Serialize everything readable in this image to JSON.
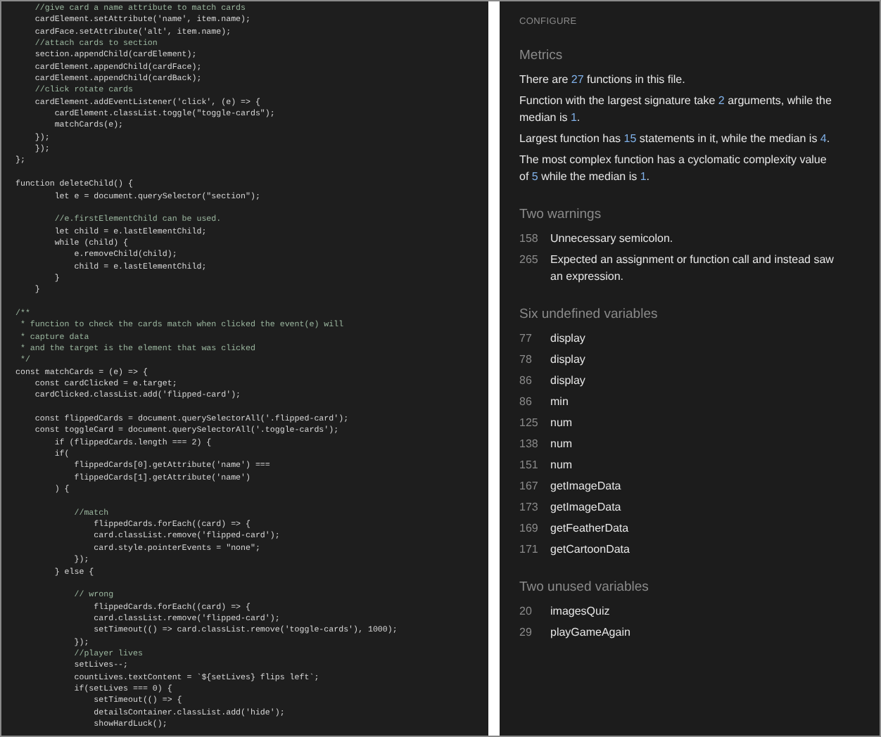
{
  "code_lines": [
    {
      "kind": "comment",
      "text": "    //give card a name attribute to match cards"
    },
    {
      "kind": "code",
      "text": "    cardElement.setAttribute('name', item.name);"
    },
    {
      "kind": "code",
      "text": "    cardFace.setAttribute('alt', item.name);"
    },
    {
      "kind": "comment",
      "text": "    //attach cards to section"
    },
    {
      "kind": "code",
      "text": "    section.appendChild(cardElement);"
    },
    {
      "kind": "code",
      "text": "    cardElement.appendChild(cardFace);"
    },
    {
      "kind": "code",
      "text": "    cardElement.appendChild(cardBack);"
    },
    {
      "kind": "comment",
      "text": "    //click rotate cards"
    },
    {
      "kind": "code",
      "text": "    cardElement.addEventListener('click', (e) => {"
    },
    {
      "kind": "code",
      "text": "        cardElement.classList.toggle(\"toggle-cards\");"
    },
    {
      "kind": "code",
      "text": "        matchCards(e);"
    },
    {
      "kind": "code",
      "text": "    });"
    },
    {
      "kind": "code",
      "text": "    });"
    },
    {
      "kind": "code",
      "text": "};"
    },
    {
      "kind": "blank"
    },
    {
      "kind": "code",
      "text": "function deleteChild() {"
    },
    {
      "kind": "code",
      "text": "        let e = document.querySelector(\"section\");"
    },
    {
      "kind": "blank"
    },
    {
      "kind": "comment",
      "text": "        //e.firstElementChild can be used."
    },
    {
      "kind": "code",
      "text": "        let child = e.lastElementChild;"
    },
    {
      "kind": "code",
      "text": "        while (child) {"
    },
    {
      "kind": "code",
      "text": "            e.removeChild(child);"
    },
    {
      "kind": "code",
      "text": "            child = e.lastElementChild;"
    },
    {
      "kind": "code",
      "text": "        }"
    },
    {
      "kind": "code",
      "text": "    }"
    },
    {
      "kind": "blank"
    },
    {
      "kind": "comment",
      "text": "/**"
    },
    {
      "kind": "comment",
      "text": " * function to check the cards match when clicked the event(e) will"
    },
    {
      "kind": "comment",
      "text": " * capture data"
    },
    {
      "kind": "comment",
      "text": " * and the target is the element that was clicked"
    },
    {
      "kind": "comment",
      "text": " */"
    },
    {
      "kind": "code",
      "text": "const matchCards = (e) => {"
    },
    {
      "kind": "code",
      "text": "    const cardClicked = e.target;"
    },
    {
      "kind": "code",
      "text": "    cardClicked.classList.add('flipped-card');"
    },
    {
      "kind": "blank"
    },
    {
      "kind": "code",
      "text": "    const flippedCards = document.querySelectorAll('.flipped-card');"
    },
    {
      "kind": "code",
      "text": "    const toggleCard = document.querySelectorAll('.toggle-cards');"
    },
    {
      "kind": "code",
      "text": "        if (flippedCards.length === 2) {"
    },
    {
      "kind": "code",
      "text": "        if("
    },
    {
      "kind": "code",
      "text": "            flippedCards[0].getAttribute('name') ==="
    },
    {
      "kind": "code",
      "text": "            flippedCards[1].getAttribute('name')"
    },
    {
      "kind": "code",
      "text": "        ) {"
    },
    {
      "kind": "blank"
    },
    {
      "kind": "comment",
      "text": "            //match"
    },
    {
      "kind": "code",
      "text": "                flippedCards.forEach((card) => {"
    },
    {
      "kind": "code",
      "text": "                card.classList.remove('flipped-card');"
    },
    {
      "kind": "code",
      "text": "                card.style.pointerEvents = \"none\";"
    },
    {
      "kind": "code",
      "text": "            });"
    },
    {
      "kind": "code",
      "text": "        } else {"
    },
    {
      "kind": "blank"
    },
    {
      "kind": "comment",
      "text": "            // wrong"
    },
    {
      "kind": "code",
      "text": "                flippedCards.forEach((card) => {"
    },
    {
      "kind": "code",
      "text": "                card.classList.remove('flipped-card');"
    },
    {
      "kind": "code",
      "text": "                setTimeout(() => card.classList.remove('toggle-cards'), 1000);"
    },
    {
      "kind": "code",
      "text": "            });"
    },
    {
      "kind": "comment",
      "text": "            //player lives"
    },
    {
      "kind": "code",
      "text": "            setLives--;"
    },
    {
      "kind": "code",
      "text": "            countLives.textContent = `${setLives} flips left`;"
    },
    {
      "kind": "code",
      "text": "            if(setLives === 0) {"
    },
    {
      "kind": "code",
      "text": "                setTimeout(() => {"
    },
    {
      "kind": "code",
      "text": "                detailsContainer.classList.add('hide');"
    },
    {
      "kind": "code",
      "text": "                showHardLuck();"
    }
  ],
  "report": {
    "configure": "CONFIGURE",
    "metrics": {
      "title": "Metrics",
      "sentences": [
        [
          {
            "kind": "text",
            "text": "There are "
          },
          {
            "kind": "number",
            "text": "27"
          },
          {
            "kind": "text",
            "text": " functions in this file."
          }
        ],
        [
          {
            "kind": "text",
            "text": "Function with the largest signature take "
          },
          {
            "kind": "number",
            "text": "2"
          },
          {
            "kind": "text",
            "text": " arguments, while the median is "
          },
          {
            "kind": "number",
            "text": "1"
          },
          {
            "kind": "text",
            "text": "."
          }
        ],
        [
          {
            "kind": "text",
            "text": "Largest function has "
          },
          {
            "kind": "number",
            "text": "15"
          },
          {
            "kind": "text",
            "text": " statements in it, while the median is "
          },
          {
            "kind": "number",
            "text": "4"
          },
          {
            "kind": "text",
            "text": "."
          }
        ],
        [
          {
            "kind": "text",
            "text": "The most complex function has a cyclomatic complexity value of "
          },
          {
            "kind": "number",
            "text": "5"
          },
          {
            "kind": "text",
            "text": " while the median is "
          },
          {
            "kind": "number",
            "text": "1"
          },
          {
            "kind": "text",
            "text": "."
          }
        ]
      ]
    },
    "sections": [
      {
        "title": "Two warnings",
        "rows": [
          {
            "line": "158",
            "message": "Unnecessary semicolon."
          },
          {
            "line": "265",
            "message": "Expected an assignment or function call and instead saw an expression."
          }
        ]
      },
      {
        "title": "Six undefined variables",
        "rows": [
          {
            "line": "77",
            "message": "display"
          },
          {
            "line": "78",
            "message": "display"
          },
          {
            "line": "86",
            "message": "display"
          },
          {
            "line": "86",
            "message": "min"
          },
          {
            "line": "125",
            "message": "num"
          },
          {
            "line": "138",
            "message": "num"
          },
          {
            "line": "151",
            "message": "num"
          },
          {
            "line": "167",
            "message": "getImageData"
          },
          {
            "line": "173",
            "message": "getImageData"
          },
          {
            "line": "169",
            "message": "getFeatherData"
          },
          {
            "line": "171",
            "message": "getCartoonData"
          }
        ]
      },
      {
        "title": "Two unused variables",
        "rows": [
          {
            "line": "20",
            "message": "imagesQuiz"
          },
          {
            "line": "29",
            "message": "playGameAgain"
          }
        ]
      }
    ]
  }
}
